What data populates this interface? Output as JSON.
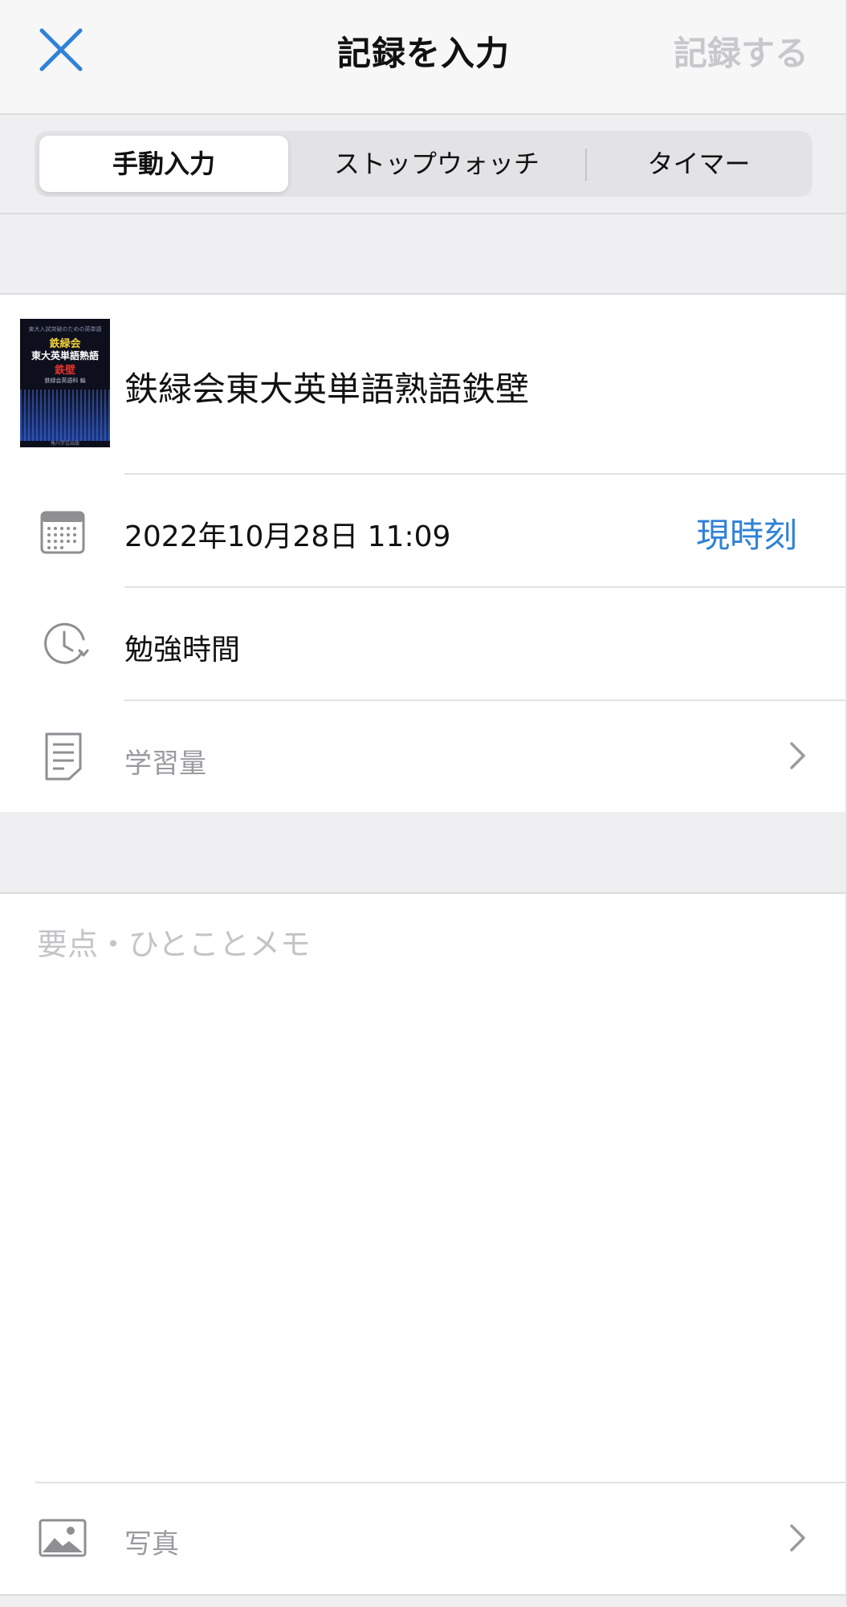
{
  "navbar": {
    "title": "記録を入力",
    "save_label": "記録する"
  },
  "segments": {
    "items": [
      {
        "label": "手動入力",
        "active": true
      },
      {
        "label": "ストップウォッチ",
        "active": false
      },
      {
        "label": "タイマー",
        "active": false
      }
    ]
  },
  "book": {
    "title": "鉄緑会東大英単語熟語鉄壁",
    "cover": {
      "small_text": "東大入試突破のための英単語",
      "line1": "鉄緑会",
      "line2": "東大英単語熟語",
      "line3": "鉄壁",
      "author": "鉄緑会英語科 編",
      "publisher": "角川学芸出版"
    }
  },
  "datetime": {
    "value": "2022年10月28日 11:09",
    "now_label": "現時刻"
  },
  "study_time": {
    "label": "勉強時間"
  },
  "study_amount": {
    "placeholder": "学習量"
  },
  "memo": {
    "placeholder": "要点・ひとことメモ",
    "value": ""
  },
  "photo": {
    "label": "写真"
  },
  "colors": {
    "accent": "#2f82d7",
    "disabled": "#c8c8cc",
    "background_gray": "#efeff2"
  }
}
